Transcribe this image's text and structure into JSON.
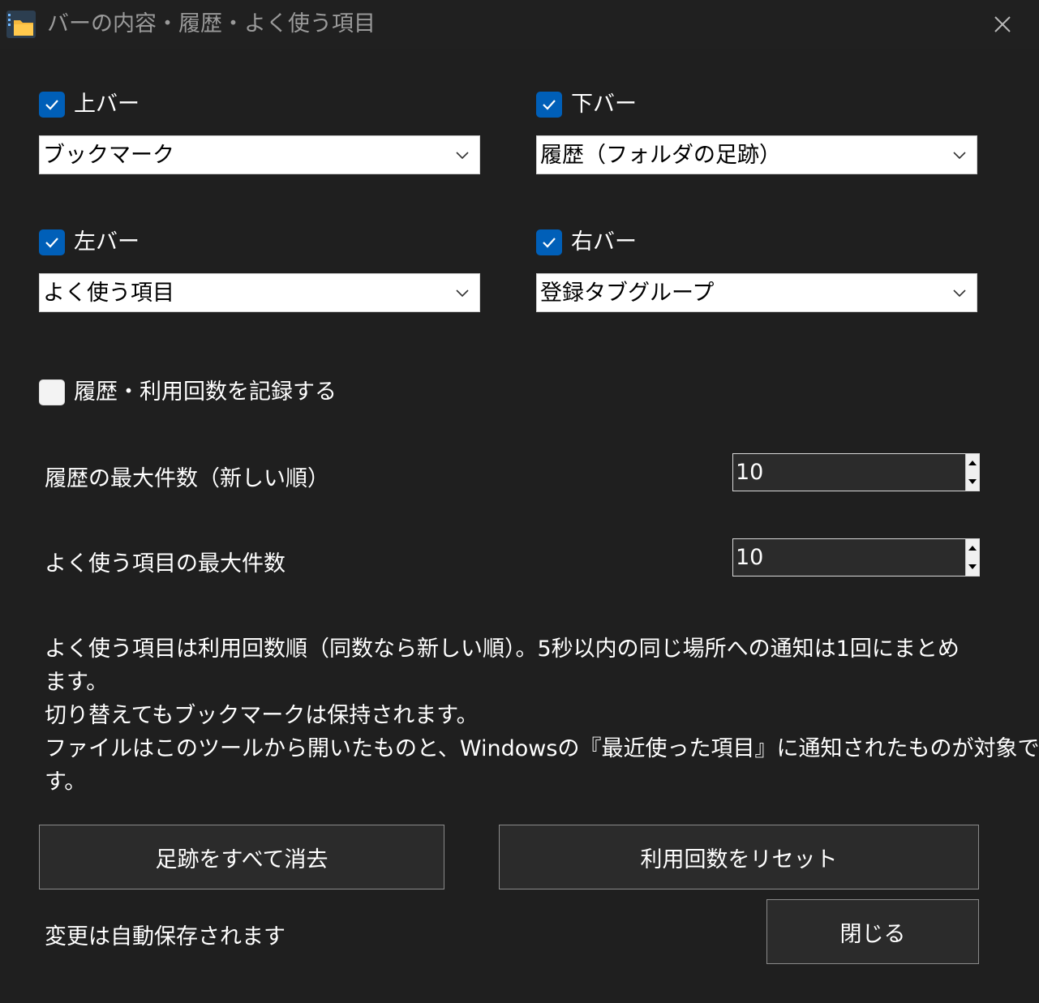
{
  "window": {
    "title": "バーの内容・履歴・よく使う項目",
    "icons": {
      "app": "folder-app-icon",
      "close": "close-icon"
    }
  },
  "bars": {
    "top": {
      "label": "上バー",
      "checked": true,
      "selected": "ブックマーク"
    },
    "bottom": {
      "label": "下バー",
      "checked": true,
      "selected": "履歴（フォルダの足跡）"
    },
    "left": {
      "label": "左バー",
      "checked": true,
      "selected": "よく使う項目"
    },
    "right": {
      "label": "右バー",
      "checked": true,
      "selected": "登録タブグループ"
    }
  },
  "record": {
    "label": "履歴・利用回数を記録する",
    "checked": false
  },
  "history_max": {
    "label": "履歴の最大件数（新しい順）",
    "value": "10"
  },
  "frequent_max": {
    "label": "よく使う項目の最大件数",
    "value": "10"
  },
  "description": [
    "よく使う項目は利用回数順（同数なら新しい順）。5秒以内の同じ場所への通知は1回にまとめ",
    "ます。",
    "切り替えてもブックマークは保持されます。",
    "ファイルはこのツールから開いたものと、Windowsの『最近使った項目』に通知されたものが対象で",
    "す。"
  ],
  "buttons": {
    "clear_history": "足跡をすべて消去",
    "reset_counts": "利用回数をリセット",
    "close": "閉じる"
  },
  "footer": {
    "autosave_note": "変更は自動保存されます"
  },
  "colors": {
    "accent": "#005fb8",
    "background": "#1f1f1f",
    "button_bg": "#2b2b2b"
  }
}
